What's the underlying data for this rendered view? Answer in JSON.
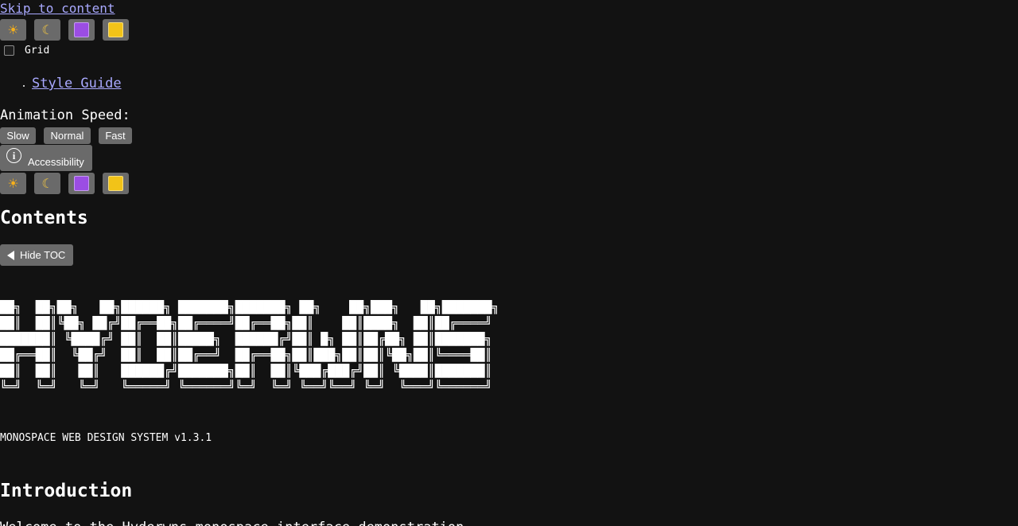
{
  "skip_link": "Skip to content",
  "theme_buttons_top": [
    {
      "icon": "sun-icon",
      "glyph": "☀"
    },
    {
      "icon": "moon-icon",
      "glyph": "☾"
    },
    {
      "icon": "purple-square-icon",
      "color": "#9b4de3"
    },
    {
      "icon": "yellow-square-icon",
      "color": "#f2c318"
    }
  ],
  "grid_toggle": {
    "label": "Grid",
    "checked": false
  },
  "nav": {
    "items": [
      {
        "label": "Style Guide"
      }
    ]
  },
  "animation": {
    "label": "Animation Speed:",
    "options": [
      "Slow",
      "Normal",
      "Fast"
    ]
  },
  "accessibility": {
    "label": "Accessibility",
    "icon": "info-icon"
  },
  "theme_buttons_bottom": [
    {
      "icon": "sun-icon",
      "glyph": "☀"
    },
    {
      "icon": "moon-icon",
      "glyph": "☾"
    },
    {
      "icon": "purple-square-icon",
      "color": "#9b4de3"
    },
    {
      "icon": "yellow-square-icon",
      "color": "#f2c318"
    }
  ],
  "toc": {
    "heading": "Contents",
    "toggle_label": "Hide TOC"
  },
  "banner_lines": [
    "██╗  ██╗██╗   ██╗██████╗ ███████╗███████╗ ██╗    ██╗███╗   ██╗███████╗",
    "██║  ██║╚██╗ ██╔╝██╔══██╗██╔════╝██╔══██╗██║    ██║████╗  ██║██╔════╝",
    "███████║ ╚████╔╝ ██║  ██║█████╗  ██████╔╝██║ █╗ ██║██╔██╗ ██║███████╗",
    "██╔══██║  ╚██╔╝  ██║  ██║██╔══╝  ██╔══██╗██║███╗██║██║╚██╗██║╚════██║",
    "██║  ██║   ██║   ██████╔╝███████╗██║  ██║╚███╔███╔╝██║ ╚████║███████║",
    "╚═╝  ╚═╝   ╚═╝   ╚═════╝ ╚══════╝╚═╝  ╚═╝ ╚══╝╚══╝ ╚═╝  ╚═══╝╚══════╝"
  ],
  "version": "MONOSPACE WEB DESIGN SYSTEM v1.3.1",
  "intro": {
    "heading": "Introduction",
    "text": "Welcome to the Hyderwns monospace interface demonstration"
  },
  "colors": {
    "background": "#121212",
    "link": "#a9a9ff",
    "button": "#6a6a6a"
  }
}
